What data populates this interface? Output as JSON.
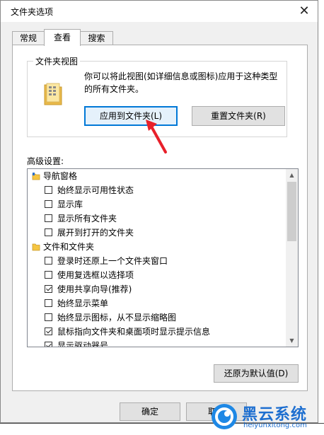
{
  "window": {
    "title": "文件夹选项",
    "close_glyph": "✕"
  },
  "tabs": [
    {
      "label": "常规",
      "active": false
    },
    {
      "label": "查看",
      "active": true
    },
    {
      "label": "搜索",
      "active": false
    }
  ],
  "folder_views": {
    "group_title": "文件夹视图",
    "description": "你可以将此视图(如详细信息或图标)应用于这种类型的所有文件夹。",
    "apply_button": "应用到文件夹(L)",
    "reset_button": "重置文件夹(R)"
  },
  "advanced": {
    "label": "高级设置:",
    "items": [
      {
        "type": "category",
        "label": "导航窗格",
        "icon": "navigation-pane-icon"
      },
      {
        "type": "checkbox",
        "label": "始终显示可用性状态",
        "checked": false
      },
      {
        "type": "checkbox",
        "label": "显示库",
        "checked": false
      },
      {
        "type": "checkbox",
        "label": "显示所有文件夹",
        "checked": false
      },
      {
        "type": "checkbox",
        "label": "展开到打开的文件夹",
        "checked": false
      },
      {
        "type": "category",
        "label": "文件和文件夹",
        "icon": "folder-icon"
      },
      {
        "type": "checkbox",
        "label": "登录时还原上一个文件夹窗口",
        "checked": false
      },
      {
        "type": "checkbox",
        "label": "使用复选框以选择项",
        "checked": false
      },
      {
        "type": "checkbox",
        "label": "使用共享向导(推荐)",
        "checked": true
      },
      {
        "type": "checkbox",
        "label": "始终显示菜单",
        "checked": false
      },
      {
        "type": "checkbox",
        "label": "始终显示图标，从不显示缩略图",
        "checked": false
      },
      {
        "type": "checkbox",
        "label": "鼠标指向文件夹和桌面项时显示提示信息",
        "checked": true
      },
      {
        "type": "checkbox",
        "label": "显示驱动器号",
        "checked": true
      }
    ],
    "restore_button": "还原为默认值(D)"
  },
  "footer": {
    "ok_button": "确定",
    "cancel_button": "取消"
  },
  "watermark": {
    "brand": "黑云系统",
    "url": "heiyunxitong.com"
  },
  "colors": {
    "accent": "#0078d7",
    "arrow": "#e8202a",
    "folder": "#f5c542"
  }
}
